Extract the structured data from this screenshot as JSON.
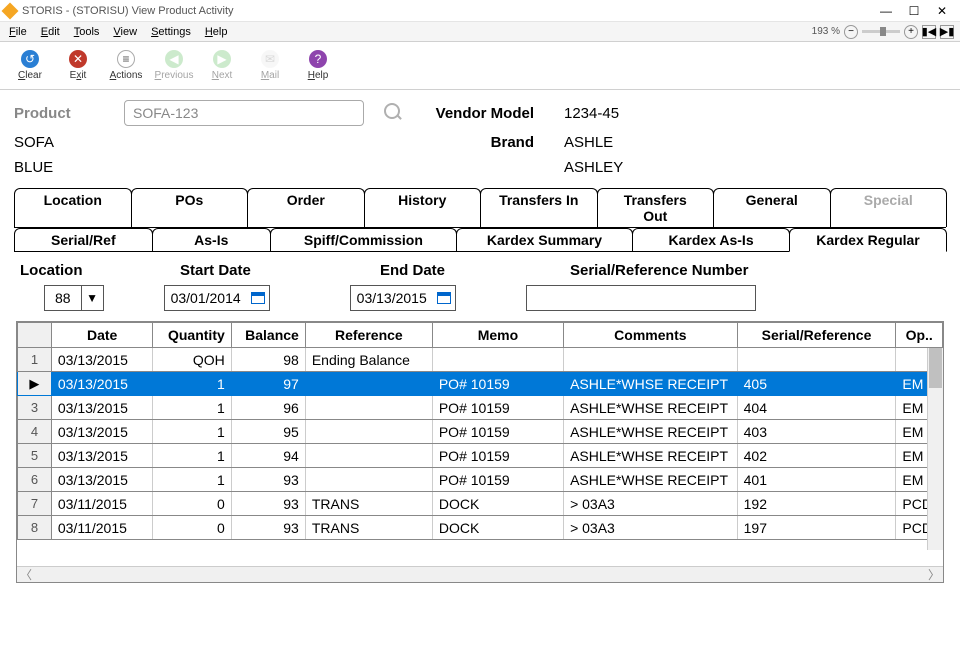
{
  "window": {
    "title": "STORIS - (STORISU) View Product Activity",
    "zoom": "193 %"
  },
  "menu": {
    "file": "File",
    "edit": "Edit",
    "tools": "Tools",
    "view": "View",
    "settings": "Settings",
    "help": "Help"
  },
  "toolbar": {
    "clear": "Clear",
    "exit": "Exit",
    "actions": "Actions",
    "previous": "Previous",
    "next": "Next",
    "mail": "Mail",
    "help": "Help"
  },
  "product": {
    "label": "Product",
    "value": "SOFA-123",
    "line1": "SOFA",
    "line2": "BLUE",
    "vendor_model_label": "Vendor Model",
    "vendor_model_value": "1234-45",
    "brand_label": "Brand",
    "brand_value": "ASHLE",
    "brand_value2": "ASHLEY"
  },
  "tabs": {
    "row1": [
      "Location",
      "POs",
      "Order",
      "History",
      "Transfers In",
      "Transfers Out",
      "General",
      "Special"
    ],
    "row2": [
      "Serial/Ref",
      "As-Is",
      "Spiff/Commission",
      "Kardex Summary",
      "Kardex As-Is",
      "Kardex Regular"
    ]
  },
  "filters": {
    "location_label": "Location",
    "location_value": "88",
    "start_label": "Start Date",
    "start_value": "03/01/2014",
    "end_label": "End Date",
    "end_value": "03/13/2015",
    "serial_label": "Serial/Reference Number",
    "serial_value": ""
  },
  "grid": {
    "headers": [
      "Date",
      "Quantity",
      "Balance",
      "Reference",
      "Memo",
      "Comments",
      "Serial/Reference",
      "Op.."
    ],
    "rows": [
      {
        "n": "1",
        "date": "03/13/2015",
        "qty": "QOH",
        "bal": "98",
        "ref": "Ending Balance",
        "memo": "",
        "cmt": "",
        "ser": "",
        "op": ""
      },
      {
        "n": "▶",
        "date": "03/13/2015",
        "qty": "1",
        "bal": "97",
        "ref": "",
        "memo": "PO# 10159",
        "cmt": "ASHLE*WHSE RECEIPT",
        "ser": "405",
        "op": "EM",
        "selected": true
      },
      {
        "n": "3",
        "date": "03/13/2015",
        "qty": "1",
        "bal": "96",
        "ref": "",
        "memo": "PO# 10159",
        "cmt": "ASHLE*WHSE RECEIPT",
        "ser": "404",
        "op": "EM"
      },
      {
        "n": "4",
        "date": "03/13/2015",
        "qty": "1",
        "bal": "95",
        "ref": "",
        "memo": "PO# 10159",
        "cmt": "ASHLE*WHSE RECEIPT",
        "ser": "403",
        "op": "EM"
      },
      {
        "n": "5",
        "date": "03/13/2015",
        "qty": "1",
        "bal": "94",
        "ref": "",
        "memo": "PO# 10159",
        "cmt": "ASHLE*WHSE RECEIPT",
        "ser": "402",
        "op": "EM"
      },
      {
        "n": "6",
        "date": "03/13/2015",
        "qty": "1",
        "bal": "93",
        "ref": "",
        "memo": "PO# 10159",
        "cmt": "ASHLE*WHSE RECEIPT",
        "ser": "401",
        "op": "EM"
      },
      {
        "n": "7",
        "date": "03/11/2015",
        "qty": "0",
        "bal": "93",
        "ref": "TRANS",
        "memo": "DOCK",
        "cmt": "> 03A3",
        "ser": "192",
        "op": "PCD"
      },
      {
        "n": "8",
        "date": "03/11/2015",
        "qty": "0",
        "bal": "93",
        "ref": "TRANS",
        "memo": "DOCK",
        "cmt": "> 03A3",
        "ser": "197",
        "op": "PCD"
      }
    ]
  }
}
